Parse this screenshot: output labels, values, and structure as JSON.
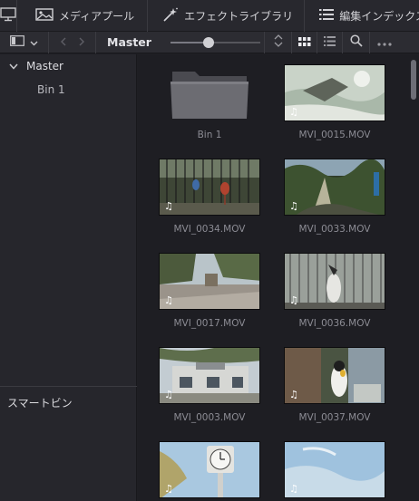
{
  "toolbar": {
    "media_pool_label": "メディアプール",
    "effects_library_label": "エフェクトライブラリ",
    "edit_index_label": "編集インデックス"
  },
  "subbar": {
    "bin_title": "Master"
  },
  "bin_tree": {
    "root": "Master",
    "bins": [
      "Bin 1"
    ]
  },
  "smart_bins_label": "スマートビン",
  "clips": [
    {
      "label": "Bin 1",
      "type": "folder"
    },
    {
      "label": "MVI_0015.MOV",
      "type": "clip",
      "scene": "water"
    },
    {
      "label": "MVI_0034.MOV",
      "type": "clip",
      "scene": "cage"
    },
    {
      "label": "MVI_0033.MOV",
      "type": "clip",
      "scene": "forest"
    },
    {
      "label": "MVI_0017.MOV",
      "type": "clip",
      "scene": "plaza"
    },
    {
      "label": "MVI_0036.MOV",
      "type": "clip",
      "scene": "birdcage"
    },
    {
      "label": "MVI_0003.MOV",
      "type": "clip",
      "scene": "building"
    },
    {
      "label": "MVI_0037.MOV",
      "type": "clip",
      "scene": "penguin"
    },
    {
      "label": "",
      "type": "clip",
      "scene": "clock"
    },
    {
      "label": "",
      "type": "clip",
      "scene": "sky"
    }
  ],
  "colors": {
    "panel_bg": "#26262c",
    "grid_bg": "#1e1e23",
    "toolbar_bg": "#28282e",
    "label_text": "#8c8c94"
  },
  "icons": {
    "monitor": "monitor-icon",
    "media_pool": "media-pool-icon",
    "effects": "magic-wand-icon",
    "index": "list-icon",
    "audio": "music-note-icon"
  }
}
